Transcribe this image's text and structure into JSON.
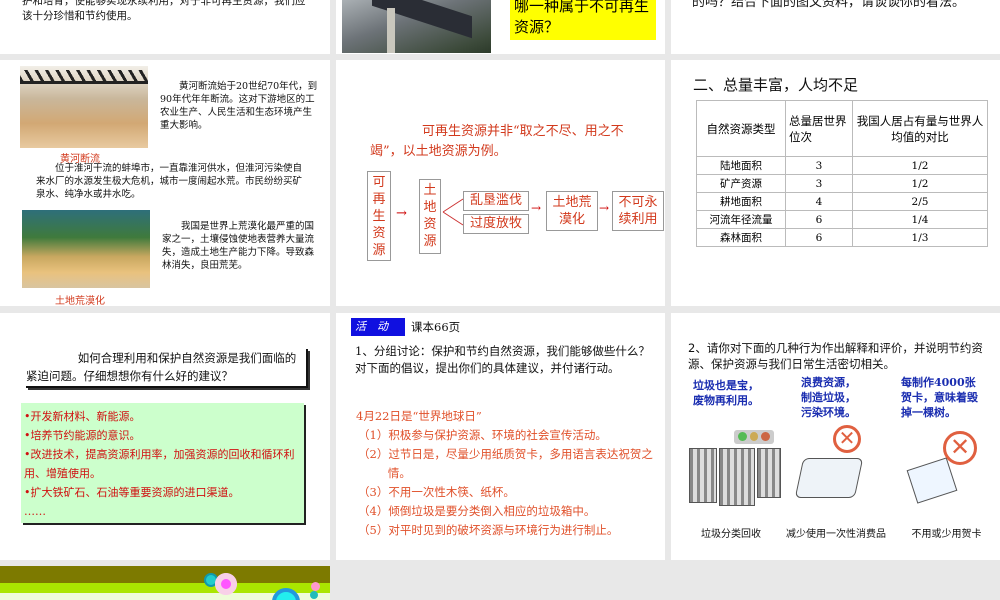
{
  "slides": {
    "s1": {
      "text": "护和培育，使能够实现永续利用，对于非可再生资源，我们应该十分珍惜和节约使用。"
    },
    "s2": {
      "question": "哪一种属于不可再生资源？"
    },
    "s3": {
      "text": "的吗？结合下面的图文资料，请谈谈你的看法。"
    },
    "s4": {
      "caption1": "黄河断流",
      "para1": "黄河断流始于20世纪70年代，到90年代年年断流。这对下游地区的工农业生产、人民生活和生态环境产生重大影响。",
      "para2": "位于淮河干流的蚌埠市，一直靠淮河供水，但淮河污染使自来水厂的水源发生极大危机，城市一度闹起水荒。市民纷纷买矿泉水、纯净水或井水吃。",
      "para3": "我国是世界上荒漠化最严重的国家之一，土壤侵蚀使地表营养大量流失，造成土地生产能力下降。导致森林消失，良田荒芜。",
      "caption2": "土地荒漠化"
    },
    "s5": {
      "intro": "可再生资源并非“取之不尽、用之不竭”，以土地资源为例。",
      "b1": "可再生资源",
      "b2": "土地资源",
      "b3": "乱垦滥伐",
      "b4": "过度放牧",
      "b5": "土地荒漠化",
      "b6": "不可永续利用"
    },
    "s6": {
      "title": "二、总量丰富，人均不足",
      "headers": [
        "自然资源类型",
        "总量居世界位次",
        "我国人居占有量与世界人均值的对比"
      ],
      "rows": [
        [
          "陆地面积",
          "3",
          "1/2"
        ],
        [
          "矿产资源",
          "3",
          "1/2"
        ],
        [
          "耕地面积",
          "4",
          "2/5"
        ],
        [
          "河流年径流量",
          "6",
          "1/4"
        ],
        [
          "森林面积",
          "6",
          "1/3"
        ]
      ]
    },
    "s7": {
      "question": "如何合理利用和保护自然资源是我们面临的紧迫问题。仔细想想你有什么好的建议？",
      "items": [
        "•开发新材料、新能源。",
        "•培养节约能源的意识。",
        "•改进技术，提高资源利用率，加强资源的回收和循环利用、增殖使用。",
        "•扩大铁矿石、石油等重要资源的进口渠道。",
        "……"
      ]
    },
    "s8": {
      "badge": "活　动",
      "page": "课本66页",
      "task": "1、分组讨论：保护和节约自然资源，我们能够做些什么？对下面的倡议，提出你们的具体建议，并付诸行动。",
      "day": "4月22日是“世界地球日”",
      "items": [
        "（1）积极参与保护资源、环境的社会宣传活动。",
        "（2）过节日是，尽量少用纸质贺卡，多用语言表达祝贺之情。",
        "（3）不用一次性木筷、纸杯。",
        "（4）倾倒垃圾是要分类倒入相应的垃圾箱中。",
        "（5）对平时见到的破坏资源与环境行为进行制止。"
      ]
    },
    "s9": {
      "task": "2、请你对下面的几种行为作出解释和评价，并说明节约资源、保护资源与我们日常生活密切相关。",
      "notes": [
        "垃圾也是宝，废物再利用。",
        "浪费资源，制造垃圾，污染环境。",
        "每制作4000张贺卡，意味着毁掉一棵树。"
      ],
      "captions": [
        "垃圾分类回收",
        "减少使用一次性消费品",
        "不用或少用贺卡"
      ]
    }
  }
}
